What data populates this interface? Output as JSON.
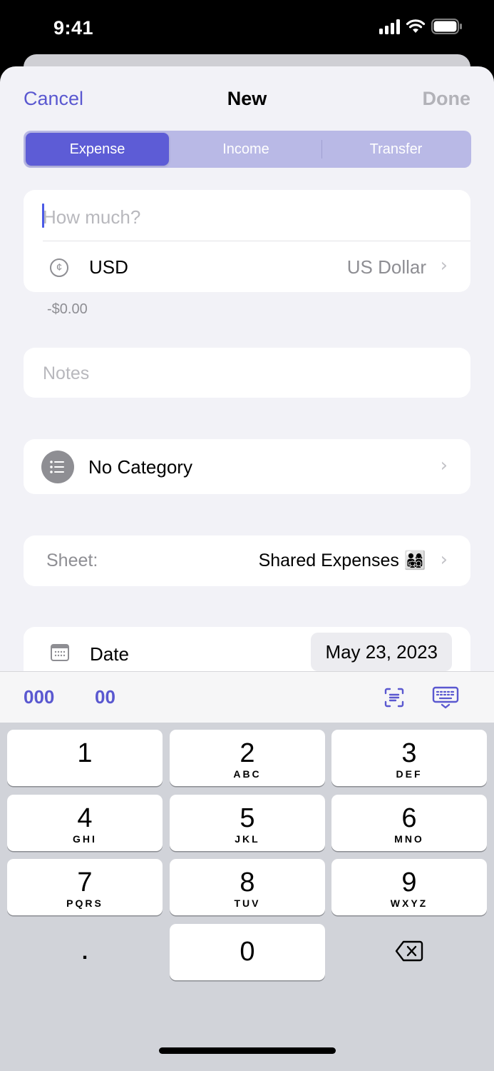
{
  "status_bar": {
    "time": "9:41"
  },
  "nav": {
    "cancel": "Cancel",
    "title": "New",
    "done": "Done"
  },
  "segments": [
    "Expense",
    "Income",
    "Transfer"
  ],
  "amount": {
    "placeholder": "How much?"
  },
  "currency": {
    "code": "USD",
    "name": "US Dollar",
    "symbol": "¢"
  },
  "converted_amount": "-$0.00",
  "notes": {
    "placeholder": "Notes"
  },
  "category": {
    "label": "No Category"
  },
  "sheet": {
    "label": "Sheet:",
    "value": "Shared Expenses 👨‍👩‍👧‍👦"
  },
  "date": {
    "label": "Date",
    "value": "May 23, 2023"
  },
  "accessory": {
    "triple_zero": "000",
    "double_zero": "00"
  },
  "keypad": {
    "keys": [
      {
        "num": "1",
        "letters": ""
      },
      {
        "num": "2",
        "letters": "ABC"
      },
      {
        "num": "3",
        "letters": "DEF"
      },
      {
        "num": "4",
        "letters": "GHI"
      },
      {
        "num": "5",
        "letters": "JKL"
      },
      {
        "num": "6",
        "letters": "MNO"
      },
      {
        "num": "7",
        "letters": "PQRS"
      },
      {
        "num": "8",
        "letters": "TUV"
      },
      {
        "num": "9",
        "letters": "WXYZ"
      }
    ],
    "decimal": ".",
    "zero": "0"
  },
  "colors": {
    "accent": "#5d5cd6",
    "segment_bg": "#b9b9e6",
    "sheet_bg": "#f2f2f7",
    "keyboard_bg": "#d1d3d9"
  }
}
